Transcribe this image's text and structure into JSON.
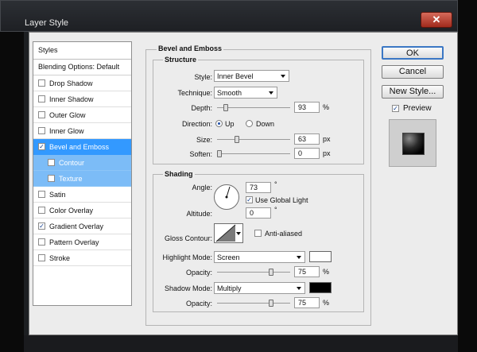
{
  "window": {
    "title": "Layer Style",
    "close_glyph": "✕"
  },
  "styles_panel": {
    "header": "Styles",
    "blending_options": "Blending Options: Default",
    "items": [
      {
        "label": "Drop Shadow",
        "checked": false
      },
      {
        "label": "Inner Shadow",
        "checked": false
      },
      {
        "label": "Outer Glow",
        "checked": false
      },
      {
        "label": "Inner Glow",
        "checked": false
      },
      {
        "label": "Bevel and Emboss",
        "checked": true
      },
      {
        "label": "Contour",
        "checked": false
      },
      {
        "label": "Texture",
        "checked": false
      },
      {
        "label": "Satin",
        "checked": false
      },
      {
        "label": "Color Overlay",
        "checked": false
      },
      {
        "label": "Gradient Overlay",
        "checked": true
      },
      {
        "label": "Pattern Overlay",
        "checked": false
      },
      {
        "label": "Stroke",
        "checked": false
      }
    ]
  },
  "bevel": {
    "section_title": "Bevel and Emboss",
    "structure": {
      "title": "Structure",
      "style_label": "Style:",
      "style_value": "Inner Bevel",
      "technique_label": "Technique:",
      "technique_value": "Smooth",
      "depth_label": "Depth:",
      "depth_value": "93",
      "depth_unit": "%",
      "depth_fraction": 0.093,
      "direction_label": "Direction:",
      "direction_up": "Up",
      "direction_down": "Down",
      "size_label": "Size:",
      "size_value": "63",
      "size_unit": "px",
      "size_fraction": 0.25,
      "soften_label": "Soften:",
      "soften_value": "0",
      "soften_unit": "px",
      "soften_fraction": 0
    },
    "shading": {
      "title": "Shading",
      "angle_label": "Angle:",
      "angle_value": "73",
      "angle_unit": "°",
      "use_global_light": "Use Global Light",
      "altitude_label": "Altitude:",
      "altitude_value": "0",
      "altitude_unit": "°",
      "gloss_contour_label": "Gloss Contour:",
      "anti_aliased": "Anti-aliased",
      "highlight_mode_label": "Highlight Mode:",
      "highlight_mode_value": "Screen",
      "highlight_color": "#ffffff",
      "highlight_opacity_label": "Opacity:",
      "highlight_opacity_value": "75",
      "highlight_opacity_unit": "%",
      "highlight_opacity_fraction": 0.75,
      "shadow_mode_label": "Shadow Mode:",
      "shadow_mode_value": "Multiply",
      "shadow_color": "#000000",
      "shadow_opacity_label": "Opacity:",
      "shadow_opacity_value": "75",
      "shadow_opacity_unit": "%",
      "shadow_opacity_fraction": 0.75
    }
  },
  "buttons": {
    "ok": "OK",
    "cancel": "Cancel",
    "new_style": "New Style...",
    "preview": "Preview"
  }
}
